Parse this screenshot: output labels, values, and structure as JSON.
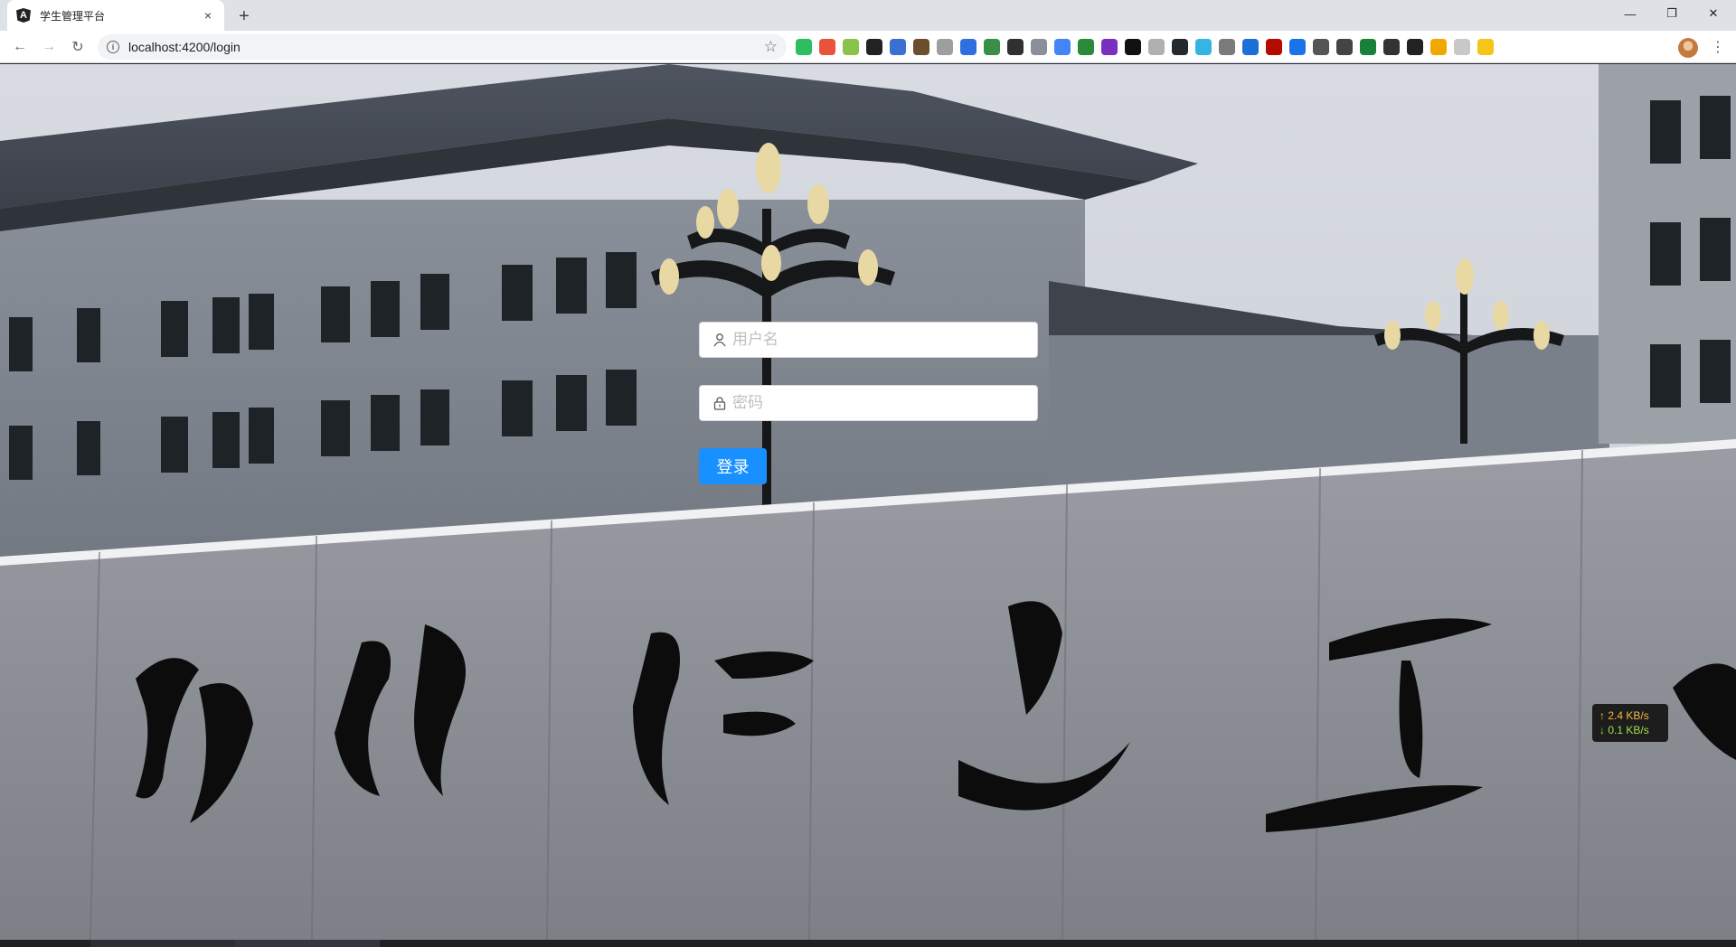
{
  "tab": {
    "title": "学生管理平台",
    "close": "×",
    "new_tab": "+"
  },
  "window": {
    "minimize": "—",
    "restore": "❐",
    "close": "✕"
  },
  "toolbar": {
    "url": "localhost:4200/login",
    "back": "←",
    "forward": "→",
    "reload": "↻",
    "star": "☆",
    "menu": "⋮"
  },
  "extensions": [
    {
      "name": "evernote-ext",
      "color": "#2dbe60"
    },
    {
      "name": "ext-red-circles",
      "color": "#e8533a"
    },
    {
      "name": "ext-green-hex",
      "color": "#8bc34a"
    },
    {
      "name": "ext-black-dots",
      "color": "#222222"
    },
    {
      "name": "ext-calendar",
      "color": "#3b6fd1"
    },
    {
      "name": "ext-cat",
      "color": "#6b4e2e"
    },
    {
      "name": "ext-gray-a",
      "color": "#9e9e9e"
    },
    {
      "name": "ext-link",
      "color": "#2f6fe0"
    },
    {
      "name": "ext-green-square",
      "color": "#3a8f47"
    },
    {
      "name": "ext-x",
      "color": "#303030"
    },
    {
      "name": "ext-bird",
      "color": "#8a8f99"
    },
    {
      "name": "translate-ext",
      "color": "#4285f4"
    },
    {
      "name": "ext-globe",
      "color": "#2a8a3a"
    },
    {
      "name": "ext-purple-rp",
      "color": "#7b2fbf"
    },
    {
      "name": "ext-jb",
      "color": "#111111"
    },
    {
      "name": "ext-gray-box",
      "color": "#b0b0b0"
    },
    {
      "name": "github-ext",
      "color": "#24292e"
    },
    {
      "name": "ext-fps",
      "color": "#35b6e0"
    },
    {
      "name": "ext-gray-c",
      "color": "#7a7a7a"
    },
    {
      "name": "ext-shield",
      "color": "#1d6fd8"
    },
    {
      "name": "ext-pdf",
      "color": "#b30b00"
    },
    {
      "name": "ext-blue-arrow",
      "color": "#1a73e8"
    },
    {
      "name": "vue-ext",
      "color": "#555555"
    },
    {
      "name": "ext-hex",
      "color": "#444444"
    },
    {
      "name": "ext-on",
      "color": "#188038"
    },
    {
      "name": "ext-cube",
      "color": "#333333"
    },
    {
      "name": "ext-window",
      "color": "#222222"
    },
    {
      "name": "ext-chrome",
      "color": "#f2a600"
    },
    {
      "name": "ext-moon",
      "color": "#c8c8c8"
    },
    {
      "name": "ext-yellow",
      "color": "#f5c518"
    }
  ],
  "login": {
    "username_placeholder": "用户名",
    "password_placeholder": "密码",
    "submit_label": "登录",
    "accent": "#1890ff"
  },
  "net_speed": {
    "up": "↑ 2.4 KB/s",
    "down": "↓ 0.1 KB/s"
  }
}
